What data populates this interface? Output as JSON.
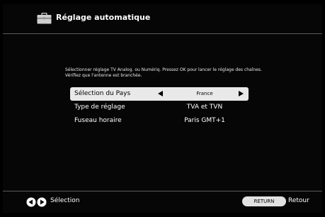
{
  "header": {
    "title": "Réglage automatique",
    "icon": "toolbox-icon"
  },
  "instructions": {
    "line1": "Sélectionner réglage TV Analog. ou Numériq. Pressez OK pour lancer le réglage des chaînes.",
    "line2": "Vérifiez que l'antenne est branchée."
  },
  "settings": [
    {
      "label": "Sélection du Pays",
      "value": "France",
      "selected": true
    },
    {
      "label": "Type de réglage",
      "value": "TVA et TVN",
      "selected": false
    },
    {
      "label": "Fuseau horaire",
      "value": "Paris GMT+1",
      "selected": false
    }
  ],
  "footer": {
    "nav_icon": "left-right-arrows-icon",
    "nav_label": "Sélection",
    "return_button": "RETURN",
    "return_label": "Retour"
  },
  "colors": {
    "background": "#000000",
    "divider": "#5c5c5c",
    "selected_row": "#e9e9e9",
    "button": "#e2e2e2"
  }
}
